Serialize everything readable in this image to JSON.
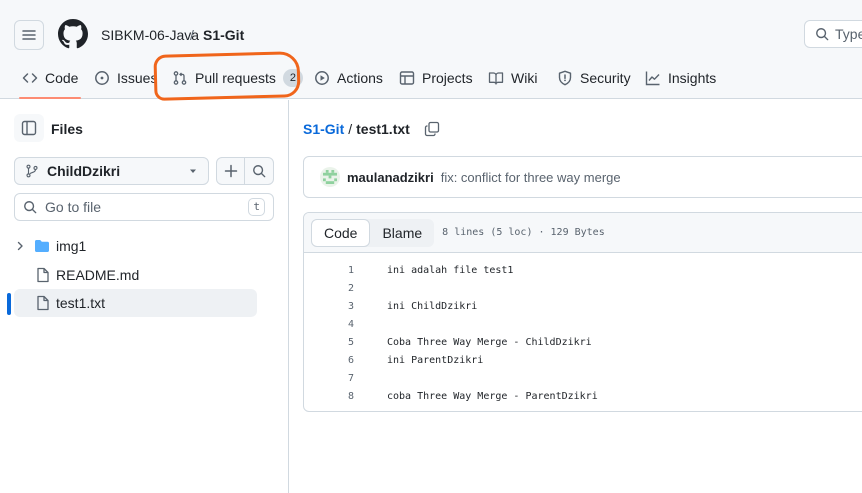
{
  "header": {
    "owner": "SIBKM-06-Java",
    "separator": "/",
    "repo": "S1-Git",
    "search_placeholder": "Type"
  },
  "tabs": [
    {
      "label": "Code",
      "icon": "code-icon",
      "active": true
    },
    {
      "label": "Issues",
      "icon": "issue-opened-icon"
    },
    {
      "label": "Pull requests",
      "icon": "git-pull-request-icon",
      "count": "2"
    },
    {
      "label": "Actions",
      "icon": "play-icon"
    },
    {
      "label": "Projects",
      "icon": "table-icon"
    },
    {
      "label": "Wiki",
      "icon": "book-icon"
    },
    {
      "label": "Security",
      "icon": "shield-icon"
    },
    {
      "label": "Insights",
      "icon": "graph-icon"
    }
  ],
  "sidebar": {
    "title": "Files",
    "branch": "ChildDzikri",
    "goto_placeholder": "Go to file",
    "goto_shortcut": "t",
    "tree": [
      {
        "name": "img1",
        "type": "folder"
      },
      {
        "name": "README.md",
        "type": "file"
      },
      {
        "name": "test1.txt",
        "type": "file",
        "selected": true
      }
    ]
  },
  "breadcrumb": {
    "repo": "S1-Git",
    "separator": "/",
    "file": "test1.txt"
  },
  "commit": {
    "author": "maulanadzikri",
    "message": "fix: conflict for three way merge"
  },
  "file_view": {
    "tab_code": "Code",
    "tab_blame": "Blame",
    "meta": "8 lines (5 loc) · 129 Bytes",
    "lines": [
      {
        "n": "1",
        "text": "ini adalah file test1"
      },
      {
        "n": "2",
        "text": ""
      },
      {
        "n": "3",
        "text": "ini ChildDzikri"
      },
      {
        "n": "4",
        "text": ""
      },
      {
        "n": "5",
        "text": "Coba Three Way Merge - ChildDzikri"
      },
      {
        "n": "6",
        "text": "ini ParentDzikri"
      },
      {
        "n": "7",
        "text": ""
      },
      {
        "n": "8",
        "text": "coba Three Way Merge - ParentDzikri"
      }
    ]
  },
  "colors": {
    "accent_link": "#0969da",
    "tab_underline": "#fd8c73",
    "annotation": "#f0651b",
    "folder": "#54aeff"
  }
}
